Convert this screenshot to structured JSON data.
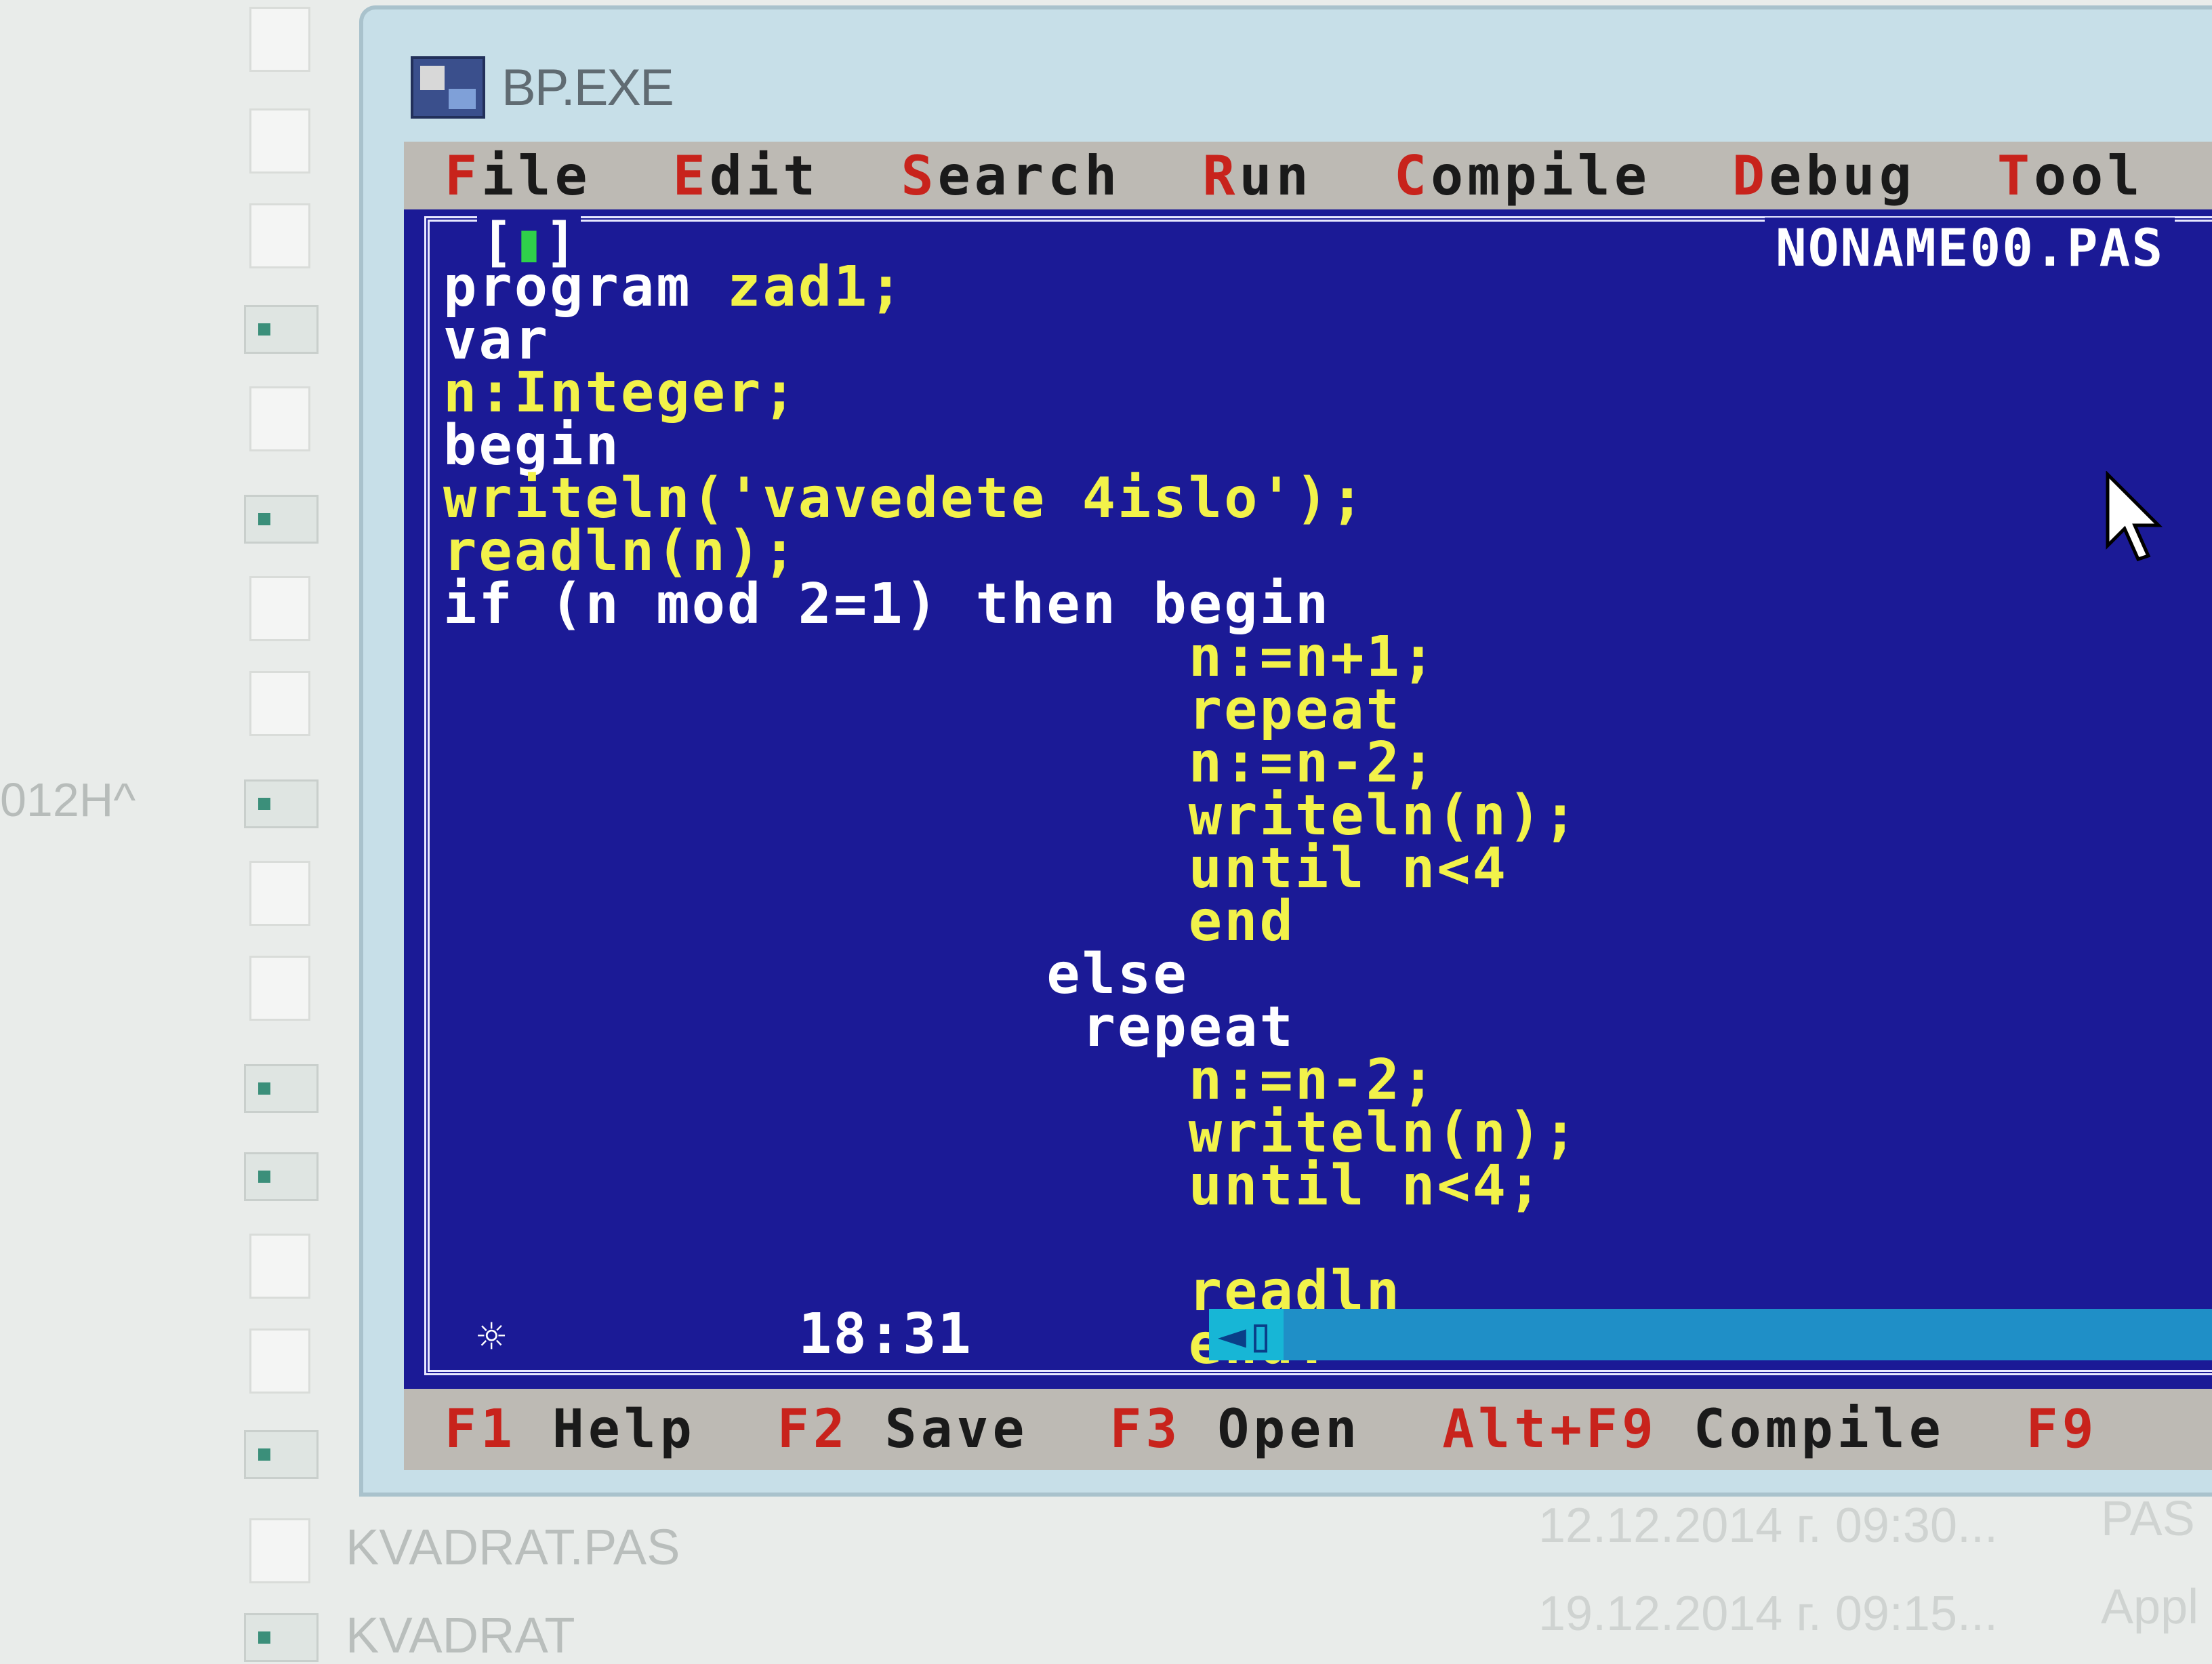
{
  "explorer": {
    "side_text": "012Н^",
    "files": [
      {
        "name": "KVADRAT.PAS",
        "date": "12.12.2014 г. 09:30...",
        "type": "PAS"
      },
      {
        "name": "KVADRAT",
        "date": "19.12.2014 г. 09:15...",
        "type": "Appl"
      }
    ]
  },
  "window": {
    "title": "BP.EXE"
  },
  "menu": [
    {
      "hotkey": "F",
      "rest": "ile"
    },
    {
      "hotkey": "E",
      "rest": "dit"
    },
    {
      "hotkey": "S",
      "rest": "earch"
    },
    {
      "hotkey": "R",
      "rest": "un"
    },
    {
      "hotkey": "C",
      "rest": "ompile"
    },
    {
      "hotkey": "D",
      "rest": "ebug"
    },
    {
      "hotkey": "T",
      "rest": "ool"
    }
  ],
  "editor": {
    "close_box_left": "[",
    "close_box_mark": "▮",
    "close_box_right": "]",
    "file_name": "NONAME00.PAS",
    "cursor_position": "18:31",
    "star": "☼",
    "scroll_arrow": "◄▯"
  },
  "code": [
    {
      "pre": "program ",
      "kw": "",
      "post": "zad1;"
    },
    {
      "pre": "var",
      "kw": "",
      "post": ""
    },
    {
      "pre": "",
      "kw": "",
      "post": "n:Integer;"
    },
    {
      "pre": "begin",
      "kw": "",
      "post": ""
    },
    {
      "pre": "",
      "kw": "",
      "post": "writeln('vavedete 4islo');"
    },
    {
      "pre": "",
      "kw": "",
      "post": "readln(n);"
    },
    {
      "pre": "if (n mod 2=1) then begin",
      "kw": "",
      "post": ""
    },
    {
      "pre": "",
      "kw": "",
      "post": "                     n:=n+1;"
    },
    {
      "pre": "",
      "kw": "",
      "post": "                     repeat"
    },
    {
      "pre": "",
      "kw": "",
      "post": "                     n:=n-2;"
    },
    {
      "pre": "",
      "kw": "",
      "post": "                     writeln(n);"
    },
    {
      "pre": "",
      "kw": "",
      "post": "                     until n<4"
    },
    {
      "pre": "",
      "kw": "",
      "post": "                     end"
    },
    {
      "pre": "                 else",
      "kw": "",
      "post": ""
    },
    {
      "pre": "                  repeat",
      "kw": "",
      "post": ""
    },
    {
      "pre": "",
      "kw": "",
      "post": "                     n:=n-2;"
    },
    {
      "pre": "",
      "kw": "",
      "post": "                     writeln(n);"
    },
    {
      "pre": "",
      "kw": "",
      "post": "                     until n<4;"
    },
    {
      "pre": "",
      "kw": "",
      "post": ""
    },
    {
      "pre": "",
      "kw": "",
      "post": "                     readln"
    },
    {
      "pre": "",
      "kw": "",
      "post": "                     end."
    }
  ],
  "status": [
    {
      "key": "F1",
      "label": " Help"
    },
    {
      "key": "F2",
      "label": " Save"
    },
    {
      "key": "F3",
      "label": " Open"
    },
    {
      "key": "Alt+F9",
      "label": " Compile"
    },
    {
      "key": "F9",
      "label": ""
    }
  ],
  "colors": {
    "dos_background": "#1b1a96",
    "code_identifier": "#f2f24a",
    "code_keyword": "#ffffff",
    "menu_background": "#bdbab4",
    "hotkey": "#c8231c"
  }
}
